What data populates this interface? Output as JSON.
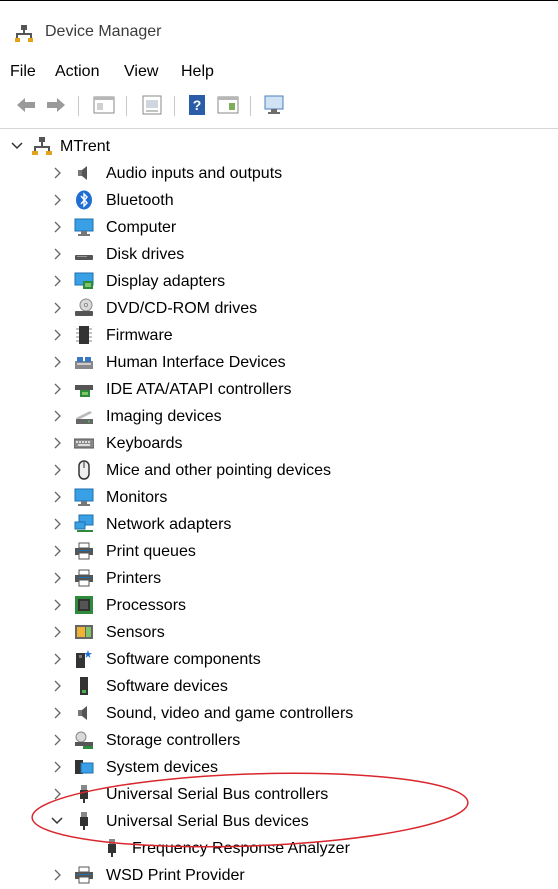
{
  "window": {
    "title": "Device Manager"
  },
  "menu": {
    "items": [
      "File",
      "Action",
      "View",
      "Help"
    ]
  },
  "toolbar": {
    "buttons": [
      "back-icon",
      "forward-icon",
      "show-hide-console-tree-icon",
      "properties-icon",
      "help-icon",
      "action-pane-icon",
      "scan-hardware-icon"
    ]
  },
  "tree": {
    "root": {
      "label": "MTrent",
      "expanded": true
    },
    "items": [
      {
        "label": "Audio inputs and outputs",
        "icon": "speaker-icon"
      },
      {
        "label": "Bluetooth",
        "icon": "bluetooth-icon"
      },
      {
        "label": "Computer",
        "icon": "computer-icon"
      },
      {
        "label": "Disk drives",
        "icon": "disk-drive-icon"
      },
      {
        "label": "Display adapters",
        "icon": "display-adapter-icon"
      },
      {
        "label": "DVD/CD-ROM drives",
        "icon": "dvd-drive-icon"
      },
      {
        "label": "Firmware",
        "icon": "firmware-chip-icon"
      },
      {
        "label": "Human Interface Devices",
        "icon": "hid-icon"
      },
      {
        "label": "IDE ATA/ATAPI controllers",
        "icon": "ide-controller-icon"
      },
      {
        "label": "Imaging devices",
        "icon": "scanner-icon"
      },
      {
        "label": "Keyboards",
        "icon": "keyboard-icon"
      },
      {
        "label": "Mice and other pointing devices",
        "icon": "mouse-icon"
      },
      {
        "label": "Monitors",
        "icon": "monitor-icon"
      },
      {
        "label": "Network adapters",
        "icon": "network-adapter-icon"
      },
      {
        "label": "Print queues",
        "icon": "printer-icon"
      },
      {
        "label": "Printers",
        "icon": "printer-icon"
      },
      {
        "label": "Processors",
        "icon": "processor-icon"
      },
      {
        "label": "Sensors",
        "icon": "sensor-icon"
      },
      {
        "label": "Software components",
        "icon": "software-component-icon"
      },
      {
        "label": "Software devices",
        "icon": "software-device-icon"
      },
      {
        "label": "Sound, video and game controllers",
        "icon": "speaker-icon"
      },
      {
        "label": "Storage controllers",
        "icon": "storage-controller-icon"
      },
      {
        "label": "System devices",
        "icon": "system-folder-icon"
      },
      {
        "label": "Universal Serial Bus controllers",
        "icon": "usb-plug-icon"
      },
      {
        "label": "Universal Serial Bus devices",
        "icon": "usb-plug-icon",
        "expanded": true,
        "children": [
          {
            "label": "Frequency Response Analyzer",
            "icon": "usb-plug-icon"
          }
        ]
      },
      {
        "label": "WSD Print Provider",
        "icon": "printer-icon"
      }
    ]
  },
  "annotation": {
    "shape": "ellipse",
    "color": "#d9262c",
    "target": "Universal Serial Bus devices"
  }
}
